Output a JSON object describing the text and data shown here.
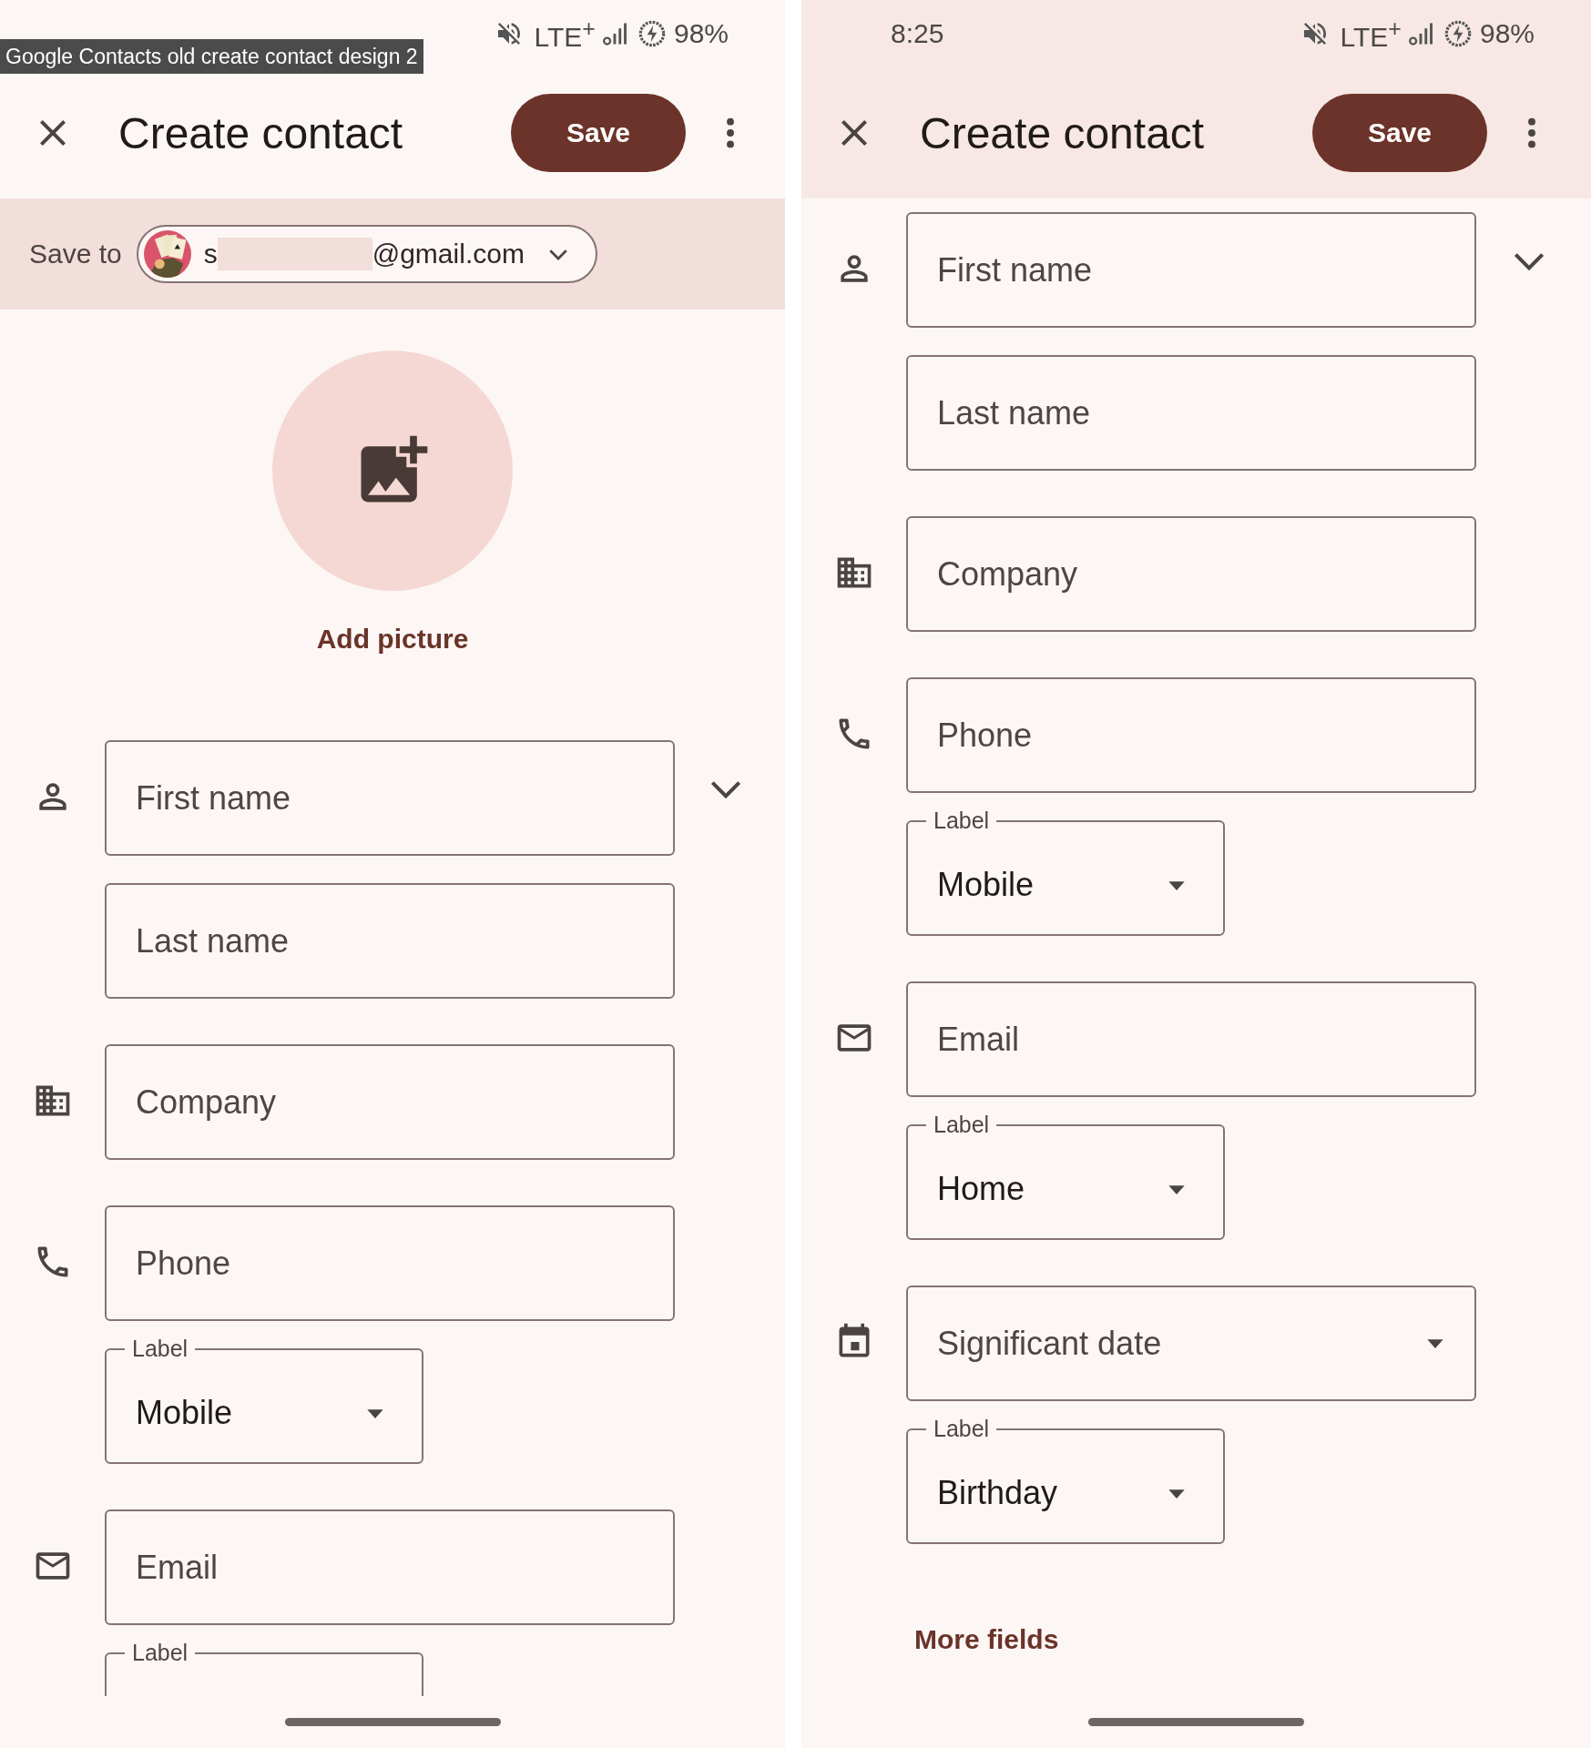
{
  "caption": "Google Contacts old create contact design 2",
  "screens": [
    {
      "scrolled": false,
      "status_bar": {
        "network": "LTE$^{+}$",
        "battery": "98%"
      },
      "header": {
        "title": "Create contact",
        "save_button": "Save"
      },
      "save_to": {
        "label": "Save to",
        "account_start": "s",
        "account_end": "@gmail.com"
      },
      "add_picture": {
        "label": "Add picture"
      },
      "sections": [
        {
          "kind": "name",
          "fields": [
            {
              "kind": "text",
              "placeholder": "First name"
            },
            {
              "kind": "text",
              "placeholder": "Last name"
            }
          ]
        },
        {
          "kind": "company",
          "fields": [
            {
              "kind": "text",
              "placeholder": "Company"
            }
          ]
        },
        {
          "kind": "phone",
          "fields": [
            {
              "kind": "text",
              "placeholder": "Phone"
            },
            {
              "kind": "select",
              "label": "Label",
              "value": "Mobile"
            }
          ]
        },
        {
          "kind": "email",
          "fields": [
            {
              "kind": "text",
              "placeholder": "Email"
            },
            {
              "kind": "select",
              "label": "Label"
            }
          ]
        }
      ]
    },
    {
      "scrolled": true,
      "status_bar": {
        "time": "8:25",
        "network": "LTE$^{+}$",
        "battery": "98%"
      },
      "header": {
        "title": "Create contact",
        "save_button": "Save"
      },
      "sections": [
        {
          "kind": "name",
          "fields": [
            {
              "kind": "text",
              "placeholder": "First name"
            },
            {
              "kind": "text",
              "placeholder": "Last name"
            }
          ]
        },
        {
          "kind": "company",
          "fields": [
            {
              "kind": "text",
              "placeholder": "Company"
            }
          ]
        },
        {
          "kind": "phone",
          "fields": [
            {
              "kind": "text",
              "placeholder": "Phone"
            },
            {
              "kind": "select",
              "label": "Label",
              "value": "Mobile"
            }
          ]
        },
        {
          "kind": "email",
          "fields": [
            {
              "kind": "text",
              "placeholder": "Email"
            },
            {
              "kind": "select",
              "label": "Label",
              "value": "Home"
            }
          ]
        },
        {
          "kind": "date",
          "fields": [
            {
              "kind": "dropdown",
              "placeholder": "Significant date"
            },
            {
              "kind": "select",
              "label": "Label",
              "value": "Birthday"
            }
          ]
        }
      ],
      "more_fields": "More fields"
    }
  ]
}
